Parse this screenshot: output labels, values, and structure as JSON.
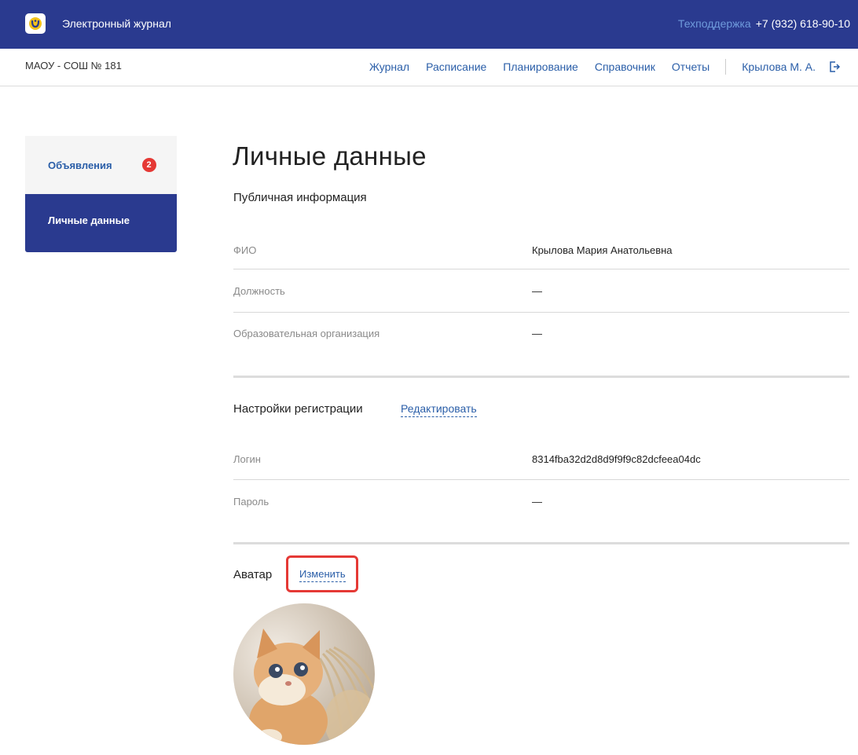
{
  "header": {
    "app_title": "Электронный журнал",
    "support_label": "Техподдержка",
    "support_phone": "+7 (932) 618-90-10"
  },
  "navbar": {
    "school": "МАОУ - СОШ № 181",
    "links": [
      "Журнал",
      "Расписание",
      "Планирование",
      "Справочник",
      "Отчеты"
    ],
    "user": "Крылова М. А."
  },
  "sidebar": {
    "items": [
      {
        "label": "Объявления",
        "badge": "2"
      },
      {
        "label": "Личные данные"
      }
    ]
  },
  "main": {
    "title": "Личные данные",
    "public_info": {
      "title": "Публичная информация",
      "rows": [
        {
          "label": "ФИО",
          "value": "Крылова Мария Анатольевна"
        },
        {
          "label": "Должность",
          "value": "—"
        },
        {
          "label": "Образовательная организация",
          "value": "—"
        }
      ]
    },
    "registration": {
      "title": "Настройки регистрации",
      "edit_label": "Редактировать",
      "rows": [
        {
          "label": "Логин",
          "value": "8314fba32d2d8d9f9f9c82dcfeea04dc"
        },
        {
          "label": "Пароль",
          "value": "—"
        }
      ]
    },
    "avatar": {
      "title": "Аватар",
      "change_label": "Изменить",
      "image": "kitten-photo"
    }
  },
  "colors": {
    "header_bg": "#2a3a8f",
    "link": "#2a5ea8",
    "badge": "#e53935",
    "highlight": "#e53935"
  }
}
